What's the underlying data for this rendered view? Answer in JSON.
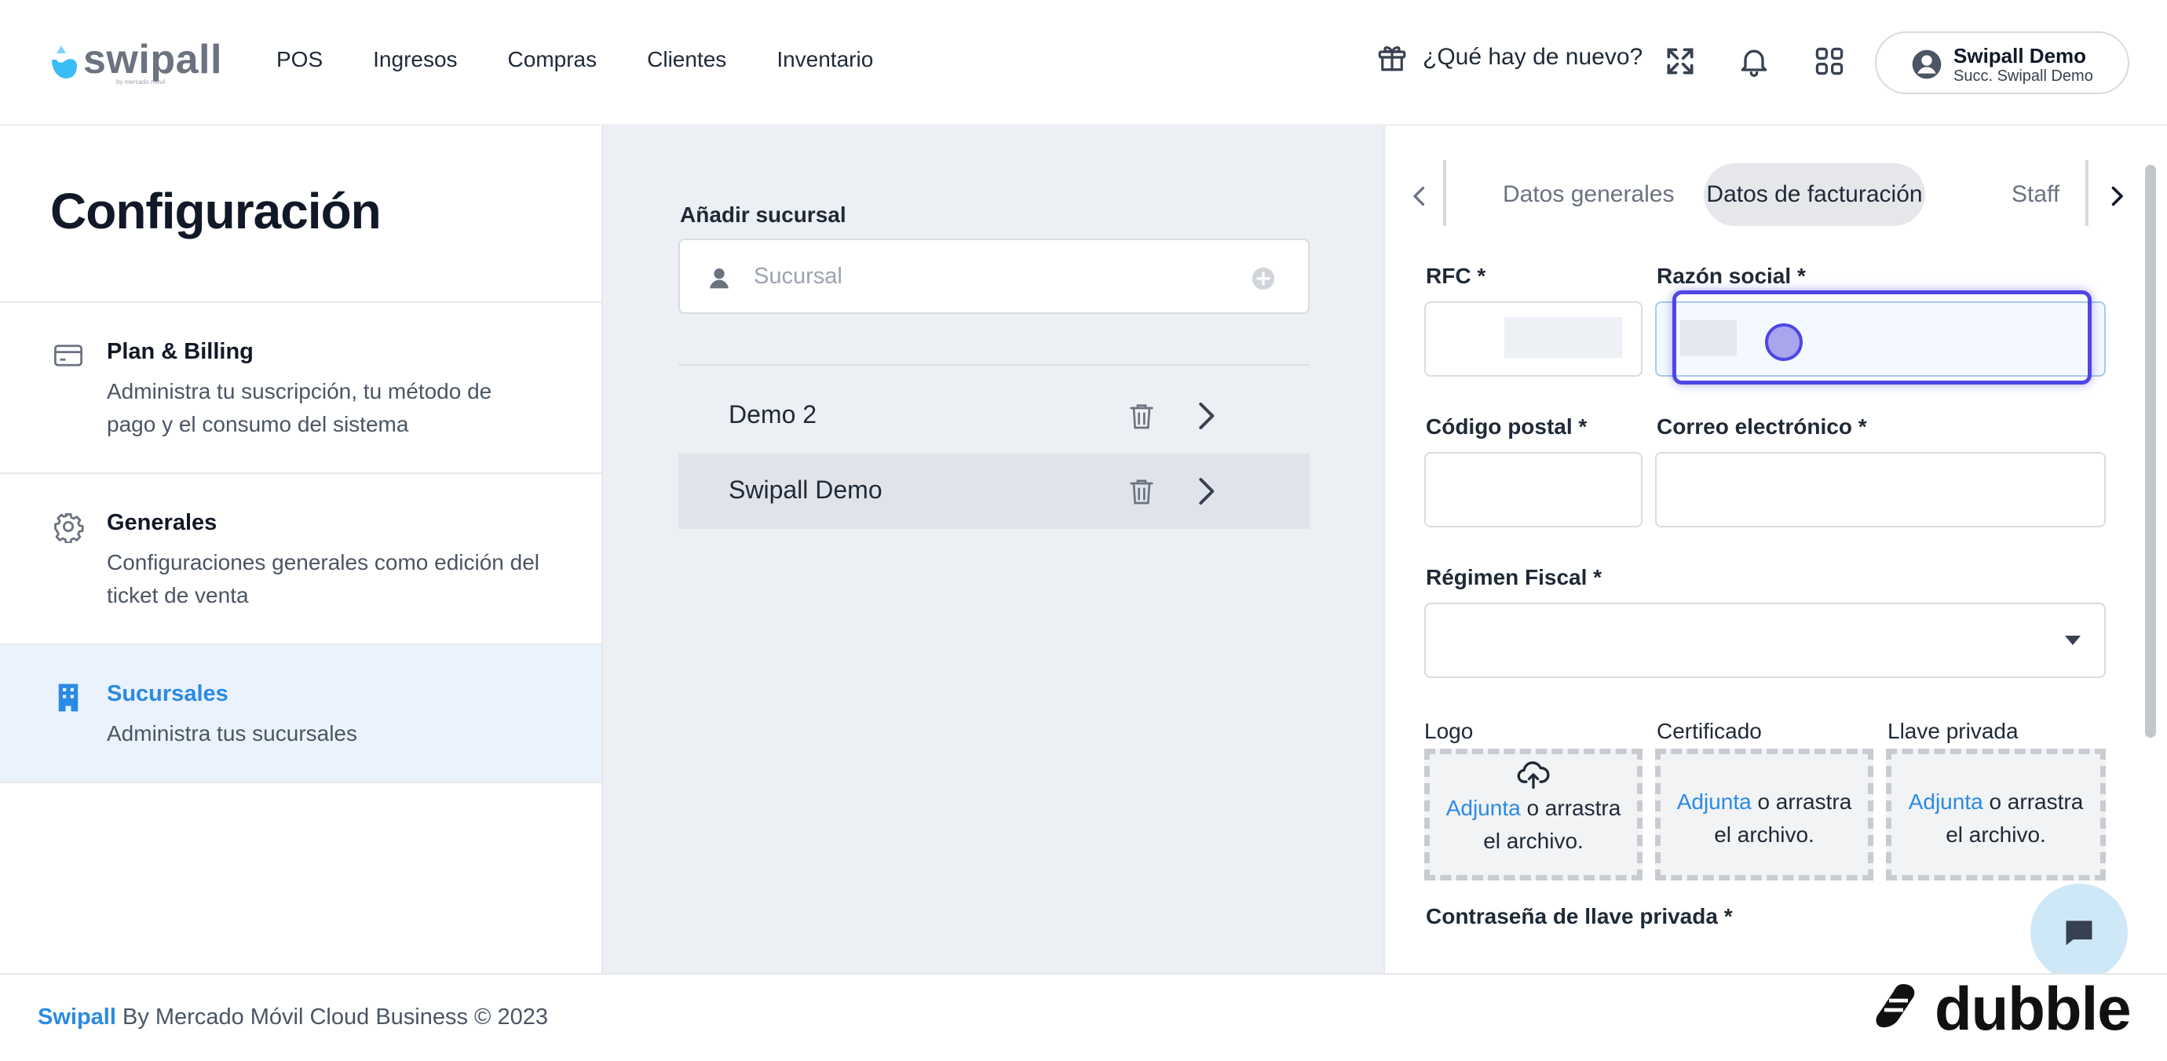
{
  "header": {
    "logo_text": "swipall",
    "logo_subtext": "by mercado movil",
    "nav": [
      "POS",
      "Ingresos",
      "Compras",
      "Clientes",
      "Inventario"
    ],
    "whats_new": "¿Qué hay de nuevo?",
    "user": {
      "name": "Swipall Demo",
      "branch": "Succ. Swipall Demo"
    }
  },
  "left": {
    "title": "Configuración",
    "menu": [
      {
        "icon": "credit-card-icon",
        "title": "Plan & Billing",
        "desc": "Administra tu suscripción, tu método de pago y el consumo del sistema"
      },
      {
        "icon": "gear-icon",
        "title": "Generales",
        "desc": "Configuraciones generales como edición del ticket de venta"
      },
      {
        "icon": "building-icon",
        "title": "Sucursales",
        "desc": "Administra tus sucursales",
        "active": true
      }
    ]
  },
  "middle": {
    "add_label": "Añadir sucursal",
    "add_placeholder": "Sucursal",
    "branches": [
      {
        "name": "Demo 2",
        "selected": false
      },
      {
        "name": "Swipall Demo",
        "selected": true
      }
    ]
  },
  "right": {
    "tabs": [
      "Datos generales",
      "Datos de facturación",
      "Staff"
    ],
    "active_tab": "Datos de facturación",
    "fields": {
      "rfc": "RFC *",
      "razon_social": "Razón social *",
      "codigo_postal": "Código postal *",
      "correo": "Correo electrónico *",
      "regimen": "Régimen Fiscal *",
      "password": "Contraseña de llave privada *"
    },
    "uploads": {
      "logo_label": "Logo",
      "cert_label": "Certificado",
      "key_label": "Llave privada",
      "link": "Adjunta",
      "text_1": " o arrastra",
      "text_2": "el archivo."
    }
  },
  "footer": {
    "brand": "Swipall",
    "rest": " By Mercado Móvil Cloud Business © 2023"
  },
  "watermark": "dubble",
  "colors": {
    "accent": "#2b8ae3",
    "active_bg": "#eaf3fd",
    "middle_bg": "#eceff3",
    "focus": "#4f46e5"
  }
}
